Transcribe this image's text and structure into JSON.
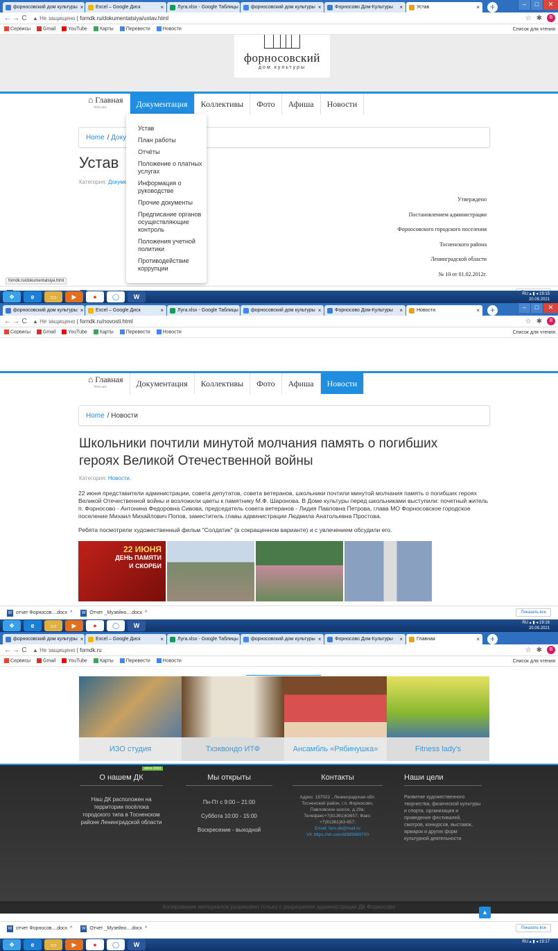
{
  "browser": {
    "tabs": [
      {
        "label": "форносовский дом культуры",
        "color": "#3a7bd5"
      },
      {
        "label": "Excel – Google Диск",
        "color": "#f4b400"
      },
      {
        "label": "Луга.xlsx - Google Таблицы",
        "color": "#0f9d58"
      },
      {
        "label": "форносовский дом культуры",
        "color": "#4285f4"
      },
      {
        "label": "Форносово Дом-Культуры",
        "color": "#3a7bd5"
      },
      {
        "label": "Устав",
        "color": "#e8a020"
      }
    ],
    "bookmarks": [
      "Сервисы",
      "Gmail",
      "YouTube",
      "Карты",
      "Перевести",
      "Новости"
    ],
    "reading_list": "Список для чтения",
    "not_secure": "Не защищено"
  },
  "screen1": {
    "url": "forndk.ru/dokumentatsiya/ustav.html",
    "tab3_label": "Луга.xlsx - Google Таблицы",
    "active_tab": "Устав",
    "logo_title": "форносовский",
    "logo_sub": "дом культуры",
    "breadcrumb_home": "Home",
    "breadcrumb_cur": "Докум",
    "title": "Устав",
    "category_label": "Категория:",
    "category_value": "Докуме",
    "dropdown": [
      "Устав",
      "План работы",
      "Отчёты",
      "Положение о платных услугах",
      "Информация о руководстве",
      "Прочие документы",
      "Предписание органов осуществляющие контроль",
      "Положения учетной политики",
      "Противодействие коррупции"
    ],
    "decree": [
      "Утверждено",
      "Постановлением администрации",
      "Форносовского городского поселения",
      "Тосненского района",
      "Ленинградской области",
      "№ 10 от 01.02.2012г."
    ],
    "status_url": "forndk.ru/dokumentatsiya.html",
    "clock_time": "19:15",
    "clock_date": "20.09.2021"
  },
  "menu": {
    "home": "Главная",
    "home_sub": "Welcome",
    "items": [
      "Документация",
      "Коллективы",
      "Фото",
      "Афиша",
      "Новости"
    ]
  },
  "screen2": {
    "url": "forndk.ru/novosti.html",
    "tab3_label": "Луга.xlsx - Google Таблицы",
    "active_tab": "Новости",
    "breadcrumb_home": "Home",
    "breadcrumb_cur": "Новости",
    "title": "Школьники почтили минутой молчания память о погибших героях Великой Отечественной войны",
    "category_label": "Категория:",
    "category_value": "Новости.",
    "para1": "22 июня представители администрации, совета депутатов, совета ветеранов, школьники почтили минутой молчания память о погибших героях Великой Отечественной войны и возложили цветы к памятнику М.Ф. Шаронова. В Доме культуры перед школьниками выступили: почетный житель п. Форносово - Антонина Федоровна Сивова, председатель совета ветеранов - Лидия Павловна Петрова, глава МО Форносовское городское поселение Михаил Михайлович Попов, заместитель главы администрации Людмила Анатольевна Простова.",
    "para2": "Ребята посмотрели художественный фильм \"Солдатик\" (в сокращенном варианте) и с увлечением обсудили его.",
    "poster_line1": "22 ИЮНЯ",
    "poster_line2": "ДЕНЬ ПАМЯТИ",
    "poster_line3": "И СКОРБИ",
    "clock_time": "19:16",
    "clock_date": "20.09.2021"
  },
  "screen3": {
    "url": "forndk.ru",
    "tab3_label": "Луга.xlsx - Google Таблицы",
    "active_tab": "Главная",
    "promos": [
      "ИЗО студия",
      "Тхэквондо ИТФ",
      "Ансамбль «Рябинушка»",
      "Fitness lady's"
    ],
    "since": "since 2003",
    "about_title": "О нашем ДК",
    "about_text": "Наш ДК расположен на территории посёлока городского типа в Тосненском районе Ленинградской области",
    "open_title": "Мы открыты",
    "open_lines": [
      "Пн-Пт с 9:00 – 21:00",
      "Суббота 10:00 - 15:00",
      "Воскресение - выходной"
    ],
    "contacts_title": "Контакты",
    "contacts_text": "Адрес: 187022 , Ленинградская обл. Тосненский район, г.п. Форносово, Павловское шоссе, д.29а; Телефакс+7(81361)63657; Факс: +7(81361)63-657;",
    "contacts_email": "Email: forn.dk@mail.ru",
    "contacts_vk": "VK https://vk.com/id389989700",
    "goals_title": "Наши цели",
    "goals_text": "Развитие художественного творчества, физической культуры и спорта, организация и проведение фестивалей, смотров, конкурсов, выставок, ярмарок и других форм культурной деятельности",
    "copyright": "Копирование материалов разрешено только с разрешения администрации ДК Форносово",
    "clock_time": "19:17"
  },
  "downloads": {
    "file1": "отчет Форносов....docx",
    "file2": "Отчет _Музейно....docx",
    "show_all": "Показать все"
  },
  "os": {
    "lang": "RU"
  }
}
